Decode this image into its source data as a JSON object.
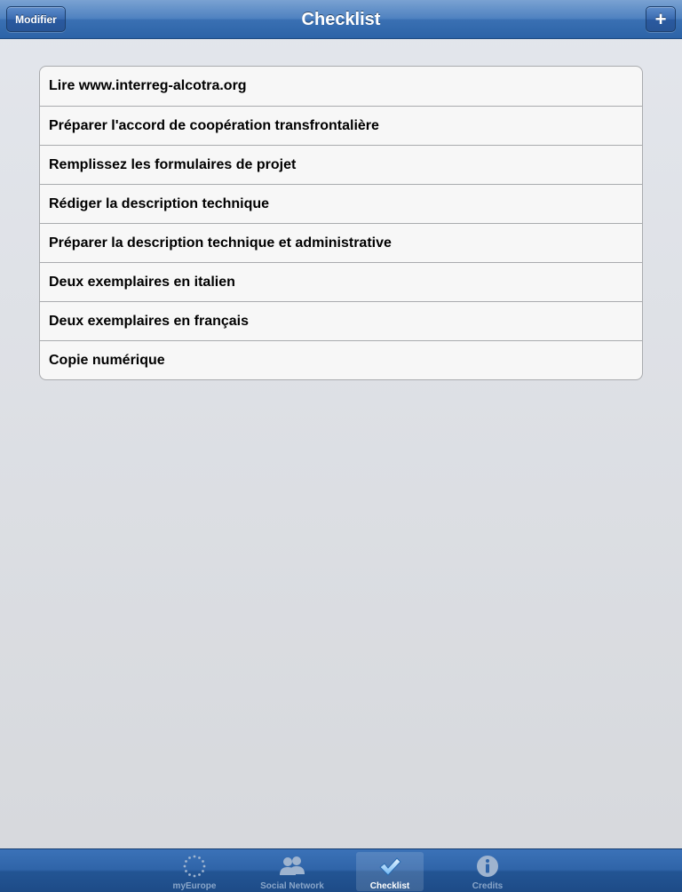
{
  "navbar": {
    "title": "Checklist",
    "left_button_label": "Modifier",
    "right_button_label": "+"
  },
  "checklist": {
    "items": [
      {
        "label": "Lire www.interreg-alcotra.org"
      },
      {
        "label": "Préparer l'accord de coopération transfrontalière"
      },
      {
        "label": "Remplissez les formulaires de projet"
      },
      {
        "label": "Rédiger la description technique"
      },
      {
        "label": "Préparer la description technique et administrative"
      },
      {
        "label": "Deux exemplaires en italien"
      },
      {
        "label": "Deux exemplaires en français"
      },
      {
        "label": "Copie numérique"
      }
    ]
  },
  "tabbar": {
    "tabs": [
      {
        "label": "myEurope",
        "icon": "eu-stars-icon",
        "selected": false
      },
      {
        "label": "Social Network",
        "icon": "people-icon",
        "selected": false
      },
      {
        "label": "Checklist",
        "icon": "checkmark-icon",
        "selected": true
      },
      {
        "label": "Credits",
        "icon": "info-icon",
        "selected": false
      }
    ]
  },
  "colors": {
    "navbar_accent": "#3a70b3",
    "tabbar_accent": "#235594",
    "selected_tab_label": "#ffffff",
    "unselected_tab_label": "#8aa6c9"
  }
}
